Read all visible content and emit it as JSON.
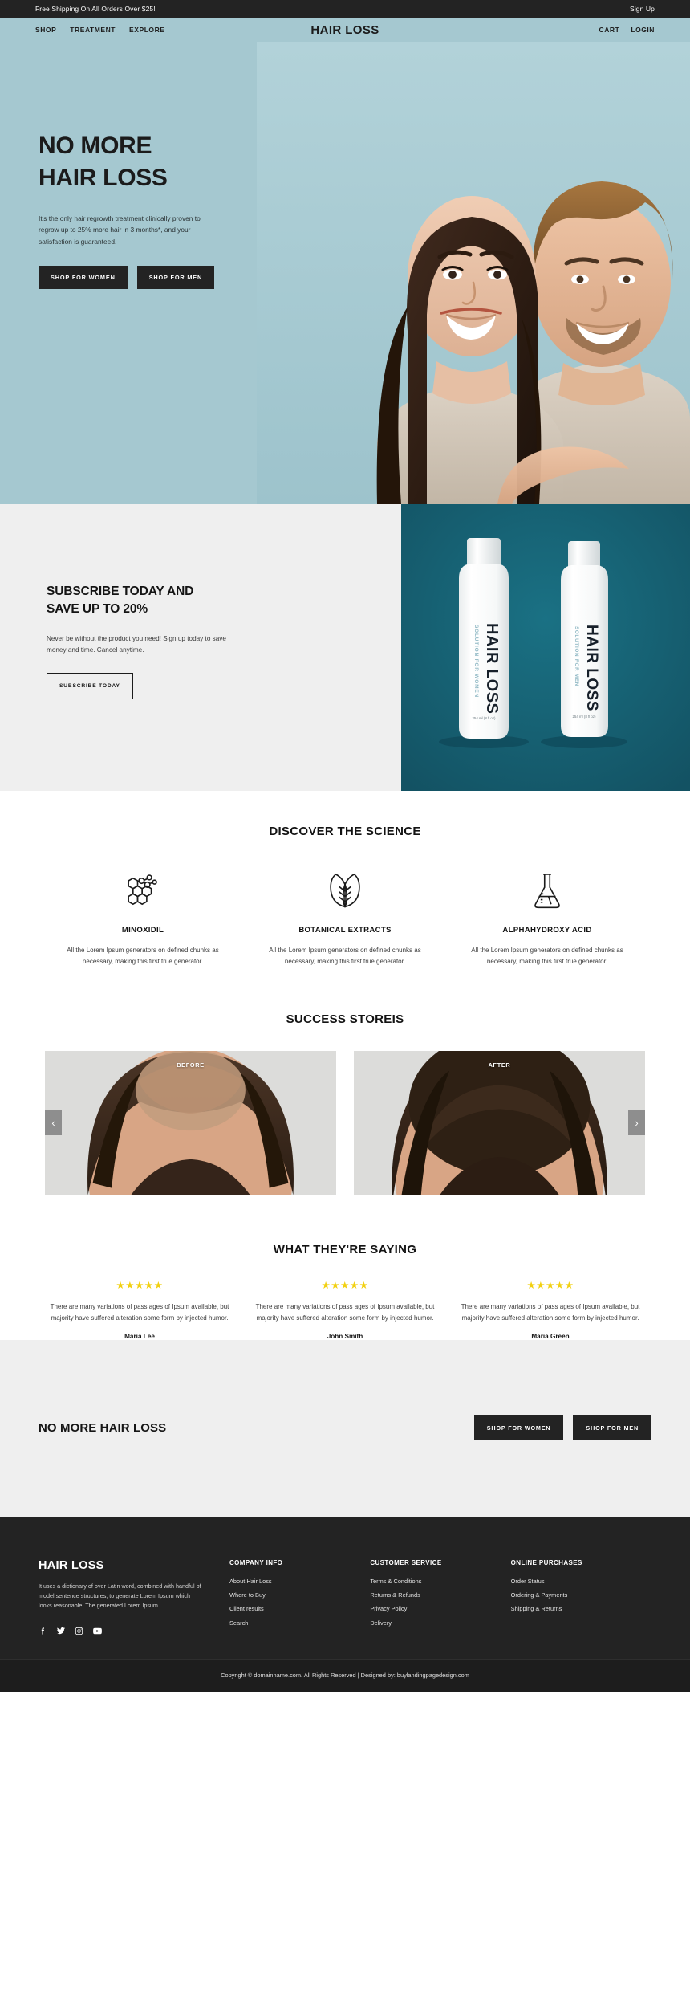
{
  "topbar": {
    "shipping_notice": "Free Shipping On All Orders Over $25!",
    "signup_label": "Sign Up"
  },
  "nav": {
    "brand": "HAIR LOSS",
    "left_links": [
      "SHOP",
      "TREATMENT",
      "EXPLORE"
    ],
    "right_links": [
      "CART",
      "LOGIN"
    ],
    "background_color": "#a5c8d0"
  },
  "hero": {
    "title_line1": "NO MORE",
    "title_line2": "HAIR LOSS",
    "paragraph": "It's the only hair regrowth treatment clinically proven to regrow up to 25% more hair in 3 months*, and your satisfaction is guaranteed.",
    "button_women": "SHOP FOR WOMEN",
    "button_men": "SHOP FOR MEN"
  },
  "subscribe": {
    "title_line1": "SUBSCRIBE TODAY AND",
    "title_line2": "SAVE UP TO 20%",
    "paragraph": "Never be without the product you need! Sign up today to save money and time. Cancel anytime.",
    "button": "SUBSCRIBE TODAY",
    "panel_color": "#165f70",
    "product_labels": {
      "brand": "HAIR LOSS",
      "variant_women": "SOLUTION FOR WOMEN",
      "variant_men": "SOLUTION FOR MEN",
      "volume": "254 ml (8 fl oz)"
    }
  },
  "science": {
    "title": "DISCOVER THE SCIENCE",
    "items": [
      {
        "icon": "molecule-icon",
        "name": "MINOXIDIL",
        "description": "All the Lorem Ipsum generators on defined chunks as necessary, making this first true generator."
      },
      {
        "icon": "leaf-icon",
        "name": "BOTANICAL EXTRACTS",
        "description": "All the Lorem Ipsum generators on defined chunks as necessary, making this first true generator."
      },
      {
        "icon": "flask-icon",
        "name": "ALPHAHYDROXY ACID",
        "description": "All the Lorem Ipsum generators on defined chunks as necessary, making this first true generator."
      }
    ]
  },
  "stories": {
    "title": "SUCCESS STOREIS",
    "before_label": "BEFORE",
    "after_label": "AFTER",
    "prev_icon": "chevron-left-icon",
    "next_icon": "chevron-right-icon"
  },
  "testimonials": {
    "title": "WHAT THEY'RE SAYING",
    "star_color": "#f2d011",
    "items": [
      {
        "stars": "★★★★★",
        "rating": 5,
        "quote": "There are many variations of pass ages of Ipsum available, but majority have suffered alteration some form by injected humor.",
        "name": "Maria Lee"
      },
      {
        "stars": "★★★★★",
        "rating": 5,
        "quote": "There are many variations of pass ages of Ipsum available, but majority have suffered alteration some form by injected humor.",
        "name": "John Smith"
      },
      {
        "stars": "★★★★★",
        "rating": 5,
        "quote": "There are many variations of pass ages of Ipsum available, but majority have suffered alteration some form by injected humor.",
        "name": "Maria Green"
      }
    ]
  },
  "cta": {
    "title": "NO MORE HAIR LOSS",
    "button_women": "SHOP FOR WOMEN",
    "button_men": "SHOP FOR MEN"
  },
  "footer": {
    "logo": "HAIR LOSS",
    "about": "It uses a dictionary of over Latin word, combined with handful of model sentence structures, to generate Lorem Ipsum which looks reasonable. The generated Lorem Ipsum.",
    "social": [
      "facebook-icon",
      "twitter-icon",
      "instagram-icon",
      "youtube-icon"
    ],
    "columns": [
      {
        "heading": "COMPANY INFO",
        "links": [
          "About Hair Loss",
          "Where to Buy",
          "Client results",
          "Search"
        ]
      },
      {
        "heading": "CUSTOMER SERVICE",
        "links": [
          "Terms & Conditions",
          "Returns & Refunds",
          "Privacy Policy",
          "Delivery"
        ]
      },
      {
        "heading": "ONLINE PURCHASES",
        "links": [
          "Order Status",
          "Ordering & Payments",
          "Shipping & Returns"
        ]
      }
    ],
    "copyright": "Copyright © domainname.com. All Rights Reserved | Designed by: buylandingpagedesign.com"
  }
}
